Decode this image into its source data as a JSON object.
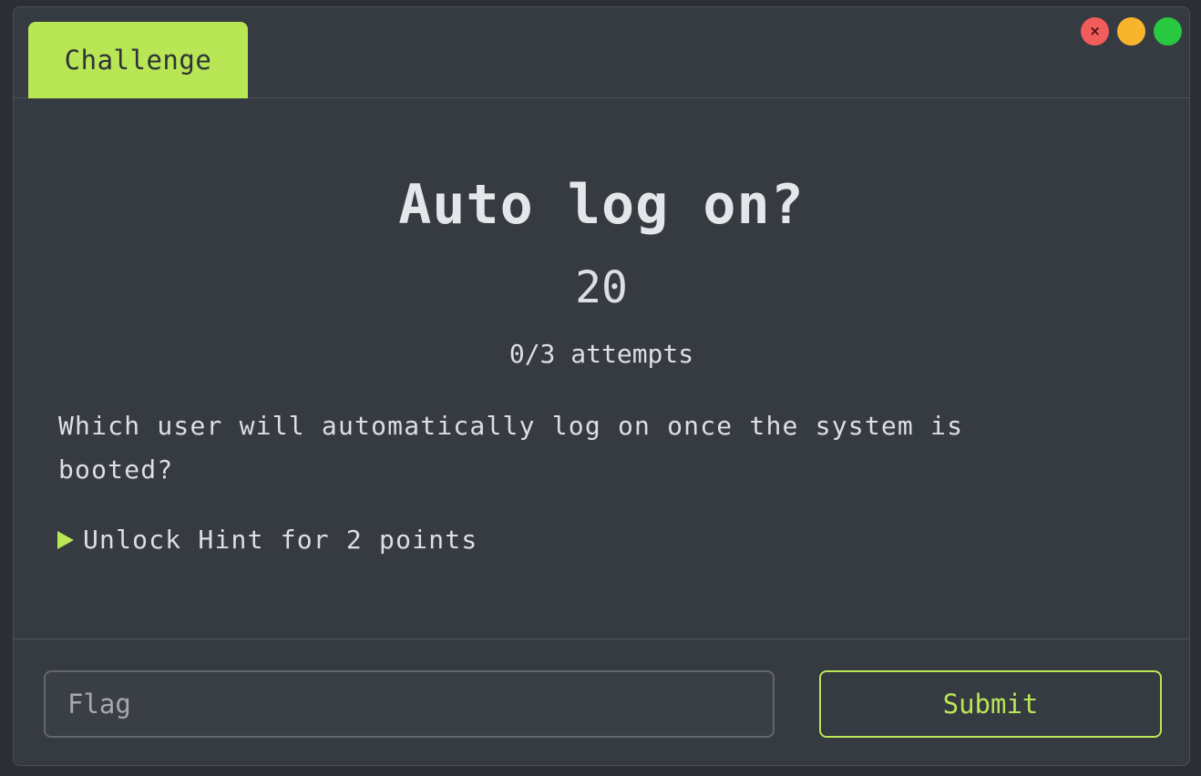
{
  "tab": {
    "label": "Challenge"
  },
  "window_controls": {
    "close_glyph": "×",
    "colors": {
      "close": "#f25c5c",
      "minimize": "#f7b52c",
      "maximize": "#28c840"
    }
  },
  "challenge": {
    "title": "Auto log on?",
    "points": "20",
    "attempts": "0/3 attempts",
    "description": "Which user will automatically log on once the system is booted?",
    "hint_label": "Unlock Hint for 2 points"
  },
  "form": {
    "flag_placeholder": "Flag",
    "flag_value": "",
    "submit_label": "Submit"
  },
  "colors": {
    "accent": "#b8e655",
    "background": "#363a41",
    "text": "#dcdfe3"
  }
}
